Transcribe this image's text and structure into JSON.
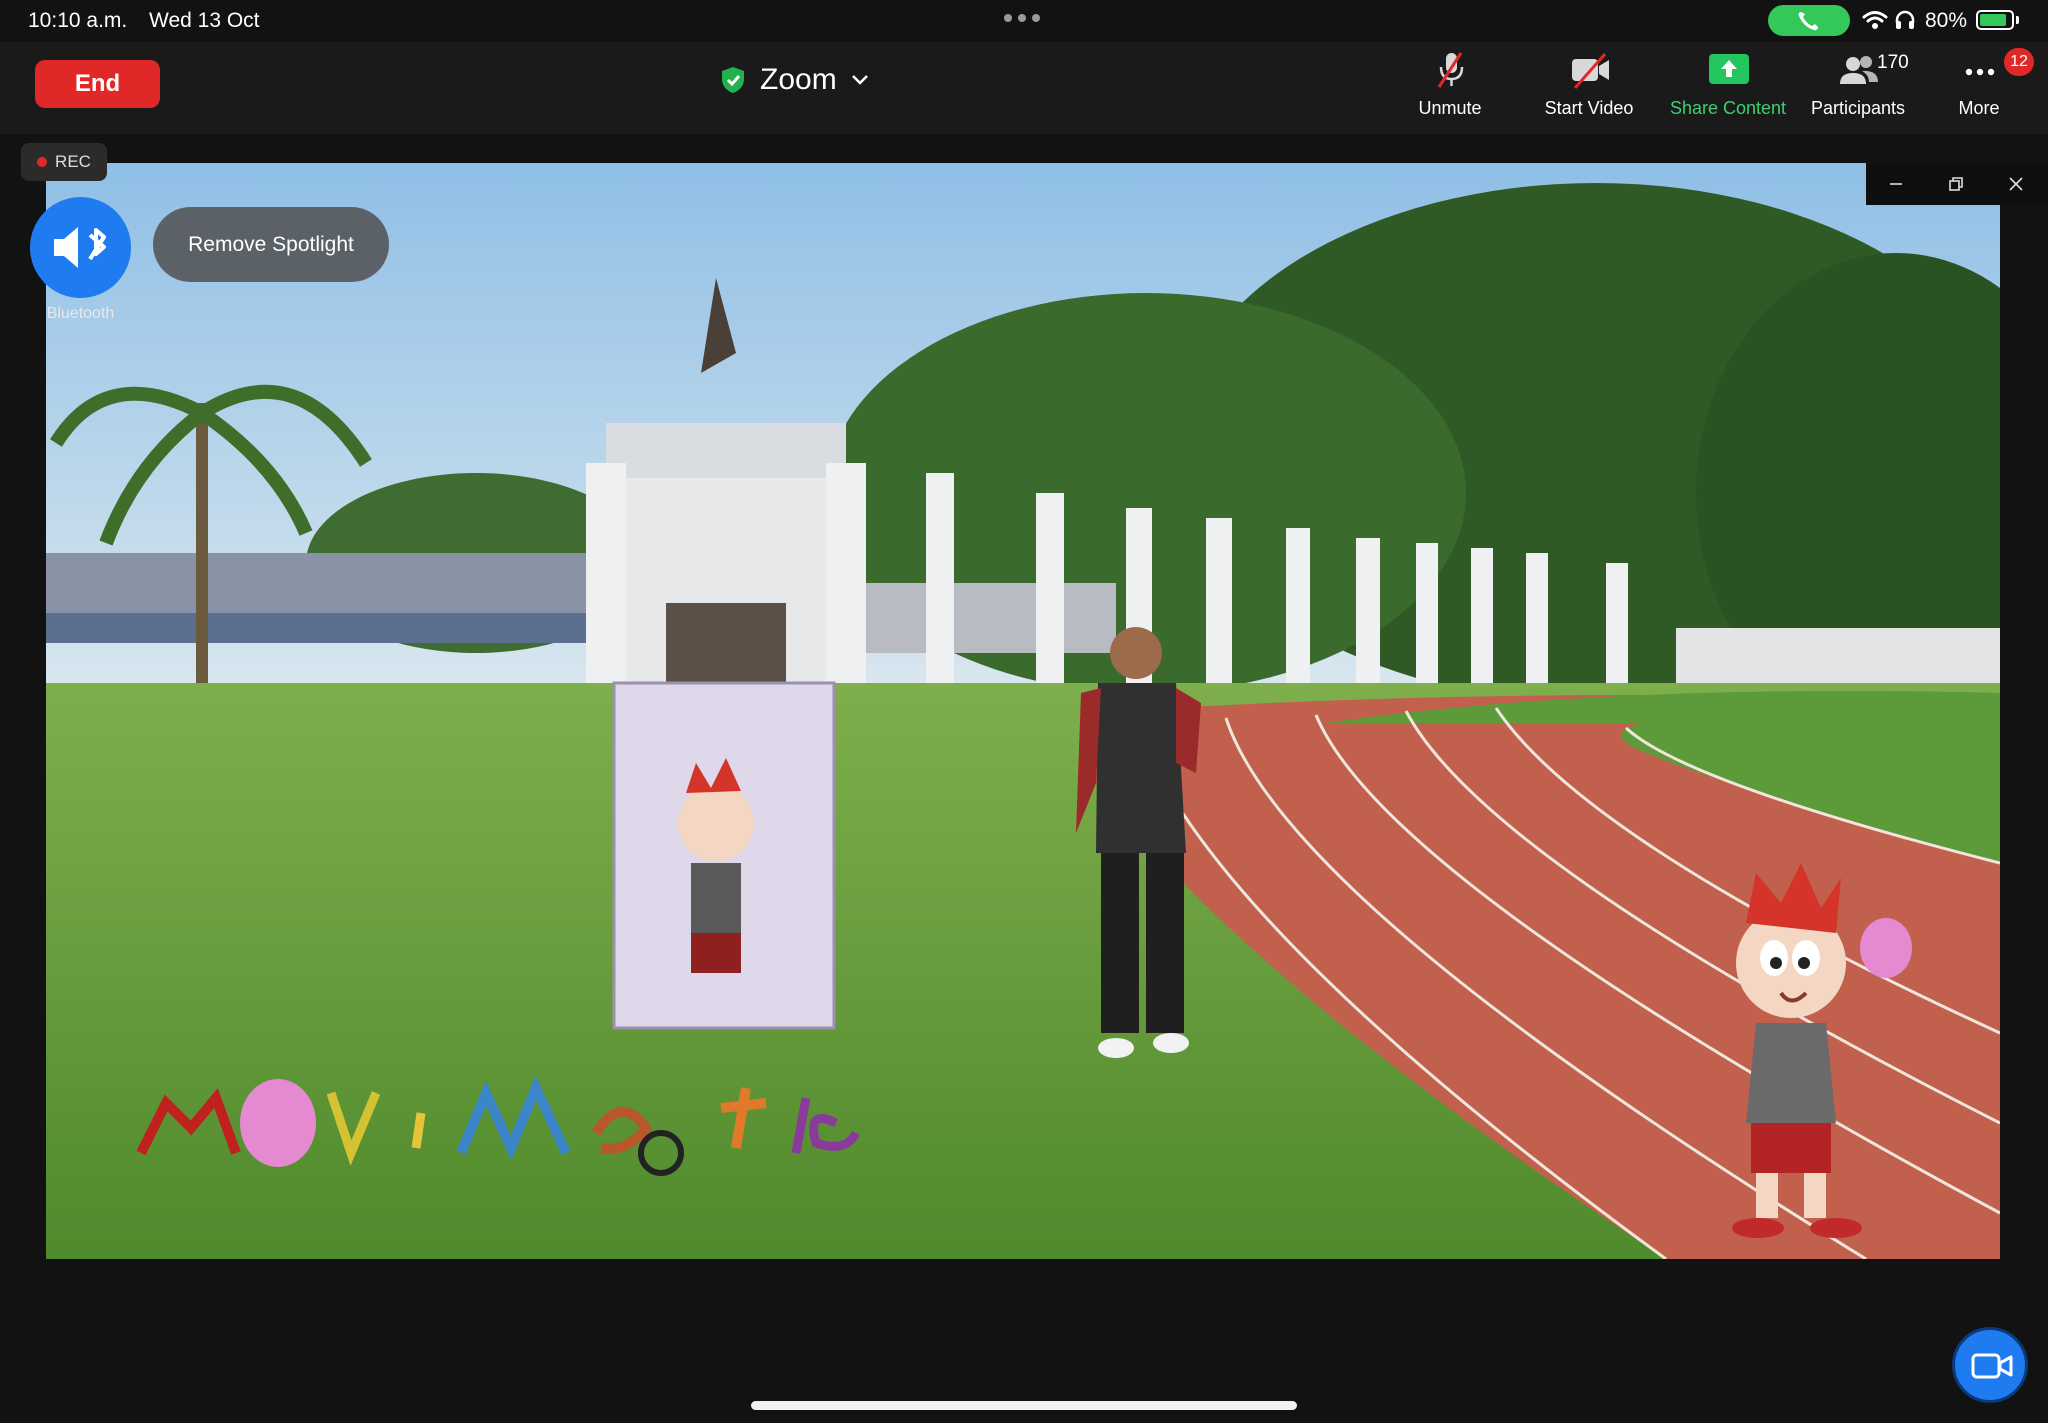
{
  "status_bar": {
    "time": "10:10 a.m.",
    "date": "Wed 13 Oct",
    "battery": "80%",
    "icons": [
      "phone-icon",
      "wifi-icon",
      "headphones-icon",
      "battery-icon"
    ]
  },
  "toolbar": {
    "end_label": "End",
    "meeting_title": "Zoom",
    "unmute_label": "Unmute",
    "start_video_label": "Start Video",
    "share_label": "Share Content",
    "participants_label": "Participants",
    "participants_count": "170",
    "more_label": "More",
    "more_badge": "12"
  },
  "recording": {
    "label": "REC"
  },
  "audio": {
    "bluetooth_label": "Bluetooth"
  },
  "spotlight": {
    "label": "Remove Spotlight"
  },
  "colors": {
    "end_red": "#e02828",
    "share_green": "#3bd16f",
    "accent_blue": "#1e7cf0",
    "call_green": "#34c759"
  }
}
